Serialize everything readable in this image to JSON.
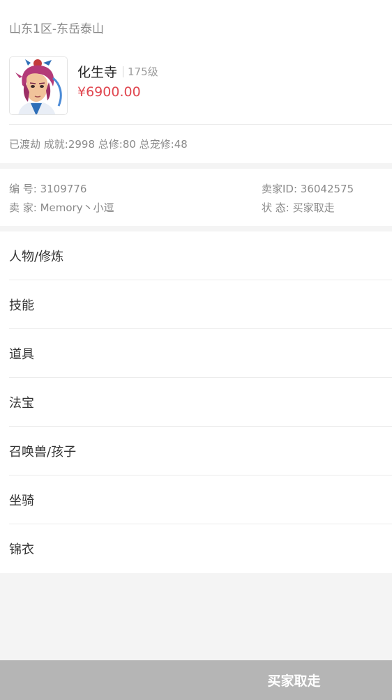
{
  "header": {
    "server": "山东1区-东岳泰山"
  },
  "character": {
    "avatar_icon": "character-portrait-icon",
    "name": "化生寺",
    "level": "175级",
    "price": "¥6900.00",
    "stats": "已渡劫 成就:2998 总修:80 总宠修:48"
  },
  "info": {
    "number": "编 号: 3109776",
    "seller": "卖 家: Memory丶小逗",
    "seller_id": "卖家ID: 36042575",
    "status": "状 态: 买家取走"
  },
  "menu": {
    "items": [
      {
        "label": "人物/修炼"
      },
      {
        "label": "技能"
      },
      {
        "label": "道具"
      },
      {
        "label": "法宝"
      },
      {
        "label": "召唤兽/孩子"
      },
      {
        "label": "坐骑"
      },
      {
        "label": "锦衣"
      }
    ]
  },
  "bottom": {
    "action_label": "买家取走"
  },
  "colors": {
    "price": "#e0464f",
    "bottom_bar": "#b5b5b5"
  }
}
